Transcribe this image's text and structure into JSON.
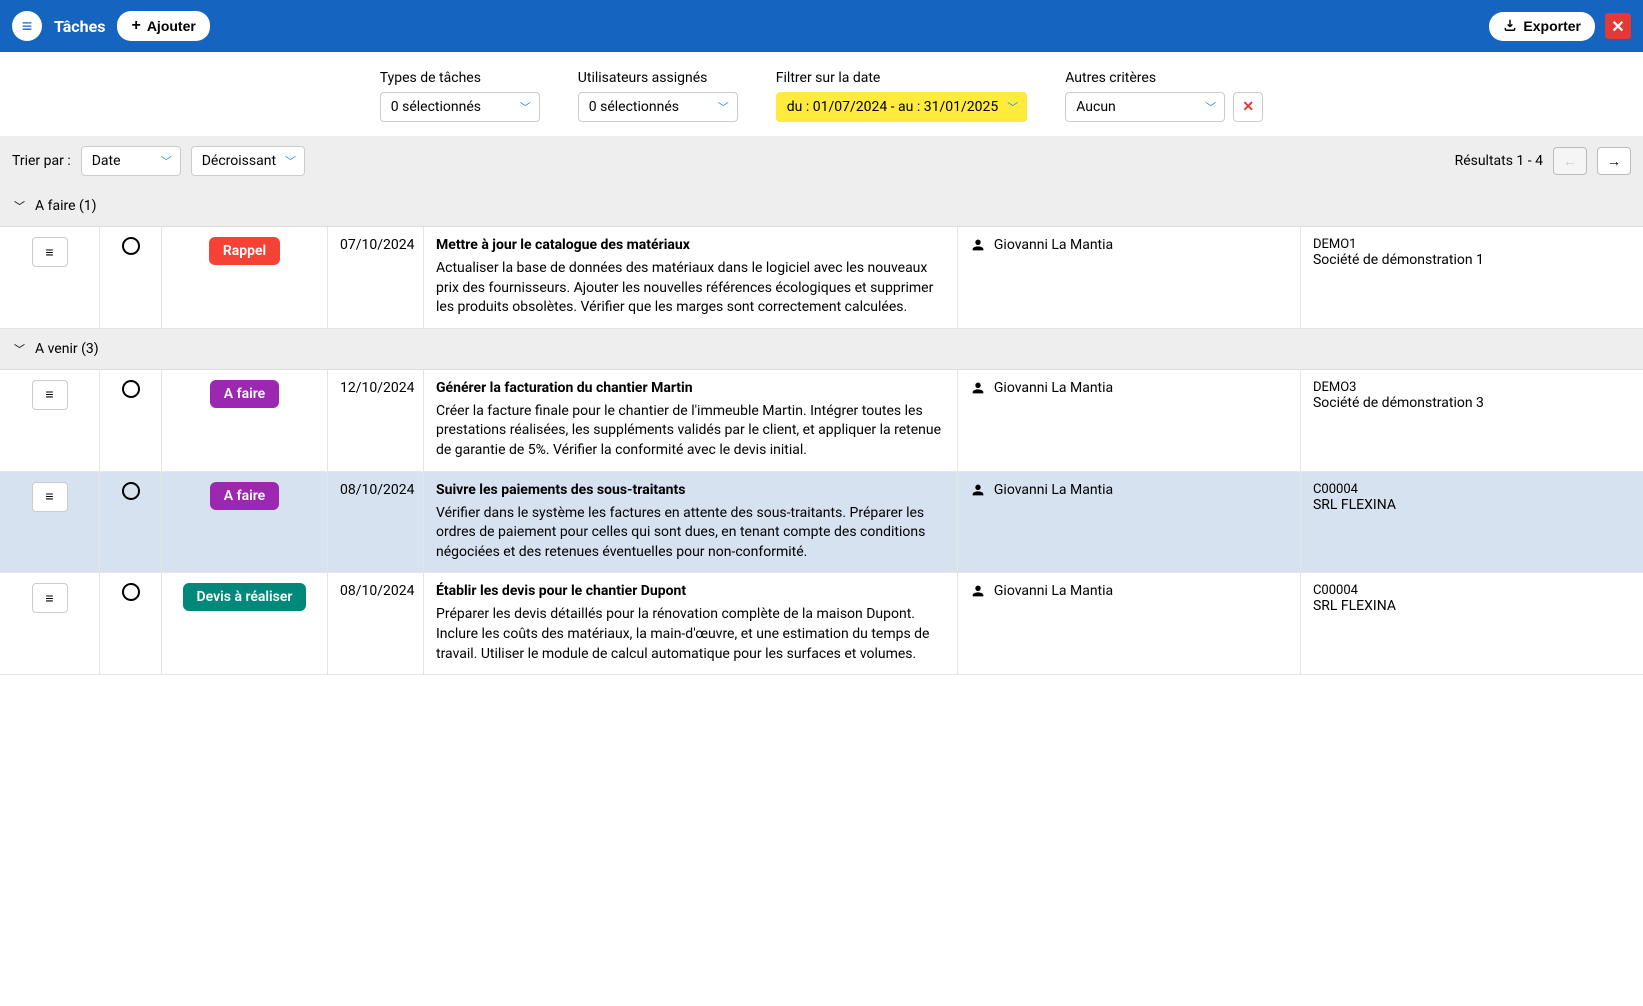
{
  "header": {
    "title": "Tâches",
    "add_label": "Ajouter",
    "export_label": "Exporter"
  },
  "filters": {
    "task_types": {
      "label": "Types de tâches",
      "value": "0 sélectionnés"
    },
    "assigned_users": {
      "label": "Utilisateurs assignés",
      "value": "0 sélectionnés"
    },
    "date_filter": {
      "label": "Filtrer sur la date",
      "value": "du : 01/07/2024 - au : 31/01/2025"
    },
    "other_criteria": {
      "label": "Autres critères",
      "value": "Aucun"
    }
  },
  "sortbar": {
    "label": "Trier par :",
    "field": "Date",
    "direction": "Décroissant",
    "results": "Résultats 1 - 4"
  },
  "groups": [
    {
      "label": "A faire (1)"
    },
    {
      "label": "A venir (3)"
    }
  ],
  "rows": [
    {
      "group": 0,
      "badge": {
        "text": "Rappel",
        "color": "red"
      },
      "date": "07/10/2024",
      "title": "Mettre à jour le catalogue des matériaux",
      "body": "Actualiser la base de données des matériaux dans le logiciel avec les nouveaux prix des fournisseurs. Ajouter les nouvelles références écologiques et supprimer les produits obsolètes. Vérifier que les marges sont correctement calculées.",
      "user": "Giovanni La Mantia",
      "company_code": "DEMO1",
      "company_name": "Société de démonstration 1",
      "highlighted": false
    },
    {
      "group": 1,
      "badge": {
        "text": "A faire",
        "color": "purple"
      },
      "date": "12/10/2024",
      "title": "Générer la facturation du chantier Martin",
      "body": "Créer la facture finale pour le chantier de l'immeuble Martin. Intégrer toutes les prestations réalisées, les suppléments validés par le client, et appliquer la retenue de garantie de 5%. Vérifier la conformité avec le devis initial.",
      "user": "Giovanni La Mantia",
      "company_code": "DEMO3",
      "company_name": "Société de démonstration 3",
      "highlighted": false
    },
    {
      "group": 1,
      "badge": {
        "text": "A faire",
        "color": "purple"
      },
      "date": "08/10/2024",
      "title": "Suivre les paiements des sous-traitants",
      "body": "Vérifier dans le système les factures en attente des sous-traitants. Préparer les ordres de paiement pour celles qui sont dues, en tenant compte des conditions négociées et des retenues éventuelles pour non-conformité.",
      "user": "Giovanni La Mantia",
      "company_code": "C00004",
      "company_name": "SRL FLEXINA",
      "highlighted": true
    },
    {
      "group": 1,
      "badge": {
        "text": "Devis à réaliser",
        "color": "teal"
      },
      "date": "08/10/2024",
      "title": "Établir les devis pour le chantier Dupont",
      "body": "Préparer les devis détaillés pour la rénovation complète de la maison Dupont. Inclure les coûts des matériaux, la main-d'œuvre, et une estimation du temps de travail. Utiliser le module de calcul automatique pour les surfaces et volumes.",
      "user": "Giovanni La Mantia",
      "company_code": "C00004",
      "company_name": "SRL FLEXINA",
      "highlighted": false
    }
  ]
}
